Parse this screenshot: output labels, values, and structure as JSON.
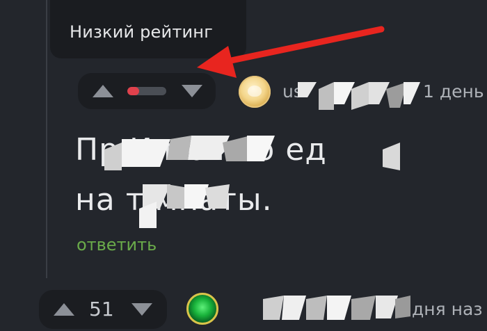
{
  "tooltip": {
    "text": "Низкий рейтинг"
  },
  "comment1": {
    "rating_bar_fill": 0.3,
    "rating_bar_color": "#e0414c",
    "username": "us",
    "time": "1 день",
    "text_line1": "Пр                  И можно ед",
    "text_line2": "на т                мнаты.",
    "reply_label": "ответить"
  },
  "comment2": {
    "score": "51",
    "time": "дня наз"
  },
  "icons": {
    "upvote": "triangle-up-icon",
    "downvote": "triangle-down-icon",
    "annotation_arrow": "red-arrow-icon"
  },
  "colors": {
    "background": "#23262c",
    "reply_green": "#6aab4a",
    "arrow_red": "#e8251f"
  }
}
